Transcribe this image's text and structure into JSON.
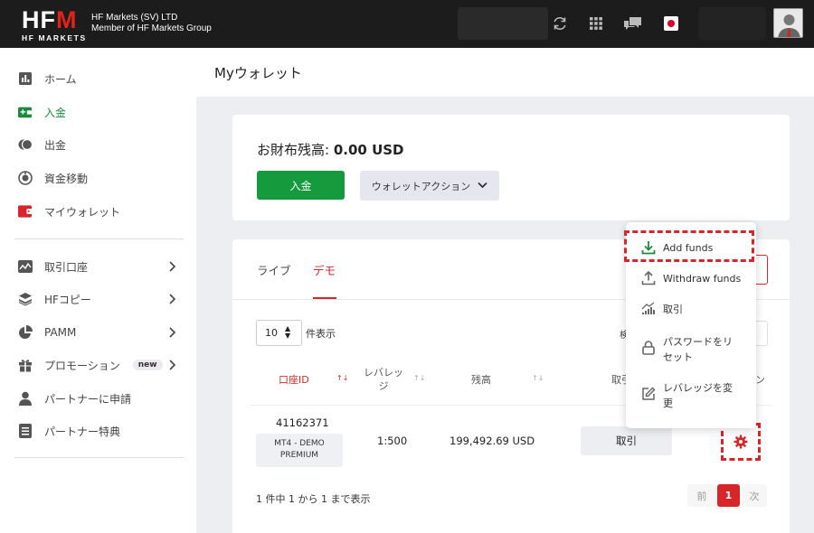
{
  "header": {
    "logo_main": "HF",
    "logo_m": "M",
    "logo_sub": "HF MARKETS",
    "company_line1": "HF Markets (SV) LTD",
    "company_line2": "Member of HF Markets Group"
  },
  "sidebar": {
    "items": [
      {
        "label": "ホーム"
      },
      {
        "label": "入金"
      },
      {
        "label": "出金"
      },
      {
        "label": "資金移動"
      },
      {
        "label": "マイウォレット"
      },
      {
        "label": "取引口座"
      },
      {
        "label": "HFコピー"
      },
      {
        "label": "PAMM"
      },
      {
        "label": "プロモーション",
        "badge": "new"
      },
      {
        "label": "パートナーに申請"
      },
      {
        "label": "パートナー特典"
      }
    ]
  },
  "page": {
    "title": "Myウォレット"
  },
  "wallet": {
    "balance_label": "お財布残高:",
    "balance_value": "0.00 USD",
    "deposit_button": "入金",
    "wallet_action_button": "ウォレットアクション"
  },
  "accounts": {
    "tabs": [
      "ライブ",
      "デモ"
    ],
    "per_page_value": "10",
    "per_page_label": "件表示",
    "search_fragment": "検",
    "columns": {
      "id": "口座ID",
      "leverage_line1": "レバレッ",
      "leverage_line2": "ジ",
      "balance": "残高",
      "trade": "取引",
      "action": "ン"
    },
    "rows": [
      {
        "id": "41162371",
        "type_line1": "MT4 - DEMO",
        "type_line2": "PREMIUM",
        "leverage": "1:500",
        "balance": "199,492.69 USD",
        "trade_button": "取引"
      }
    ],
    "paging_info": "1 件中 1 から 1 まで表示",
    "pagination": {
      "prev": "前",
      "current": "1",
      "next": "次"
    }
  },
  "action_menu": {
    "items": [
      {
        "label": "Add funds"
      },
      {
        "label": "Withdraw funds"
      },
      {
        "label": "取引"
      },
      {
        "label_line1": "パスワードをリ",
        "label_line2": "セット"
      },
      {
        "label_line1": "レバレッジを変",
        "label_line2": "更"
      }
    ]
  },
  "colors": {
    "brand_red": "#d7262a",
    "deposit_green": "#169a3e",
    "active_green": "#1b8a3a"
  }
}
